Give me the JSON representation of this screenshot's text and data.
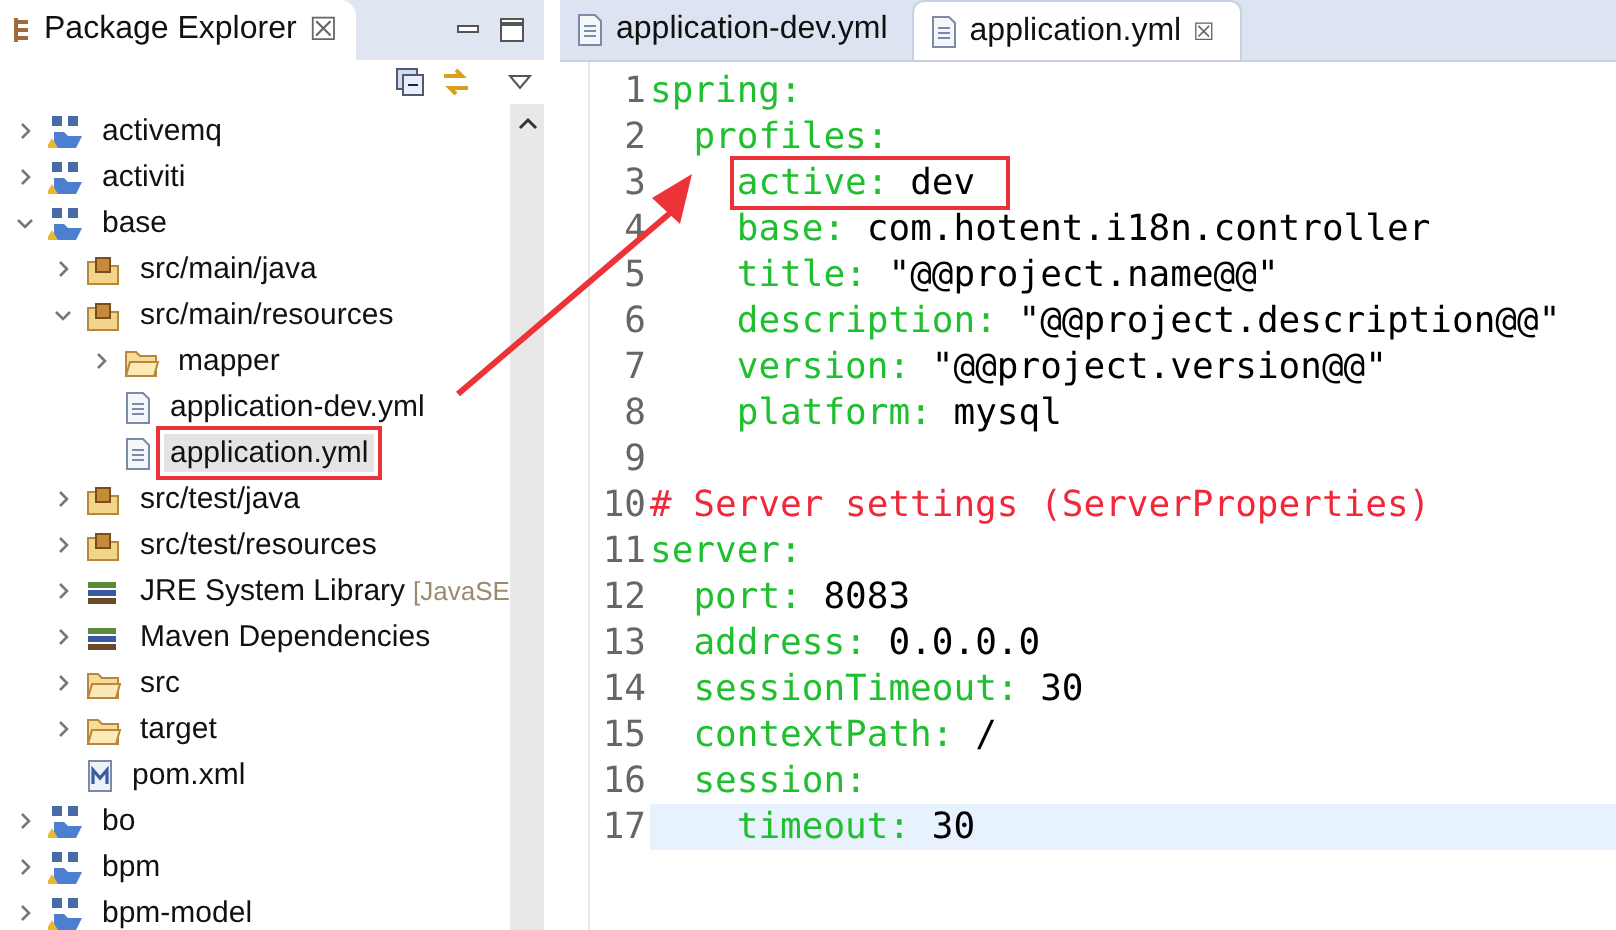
{
  "explorer": {
    "title": "Package Explorer",
    "close": "☒",
    "tree": [
      {
        "label": "activemq",
        "kind": "project",
        "expanded": false,
        "highlighted": false
      },
      {
        "label": "activiti",
        "kind": "project",
        "expanded": false,
        "highlighted": false
      },
      {
        "label": "base",
        "kind": "project",
        "expanded": true,
        "highlighted": false,
        "children": [
          {
            "label": "src/main/java",
            "kind": "package",
            "expanded": false,
            "highlighted": false
          },
          {
            "label": "src/main/resources",
            "kind": "package",
            "expanded": true,
            "highlighted": false,
            "children": [
              {
                "label": "mapper",
                "kind": "folder",
                "expanded": false,
                "highlighted": false
              },
              {
                "label": "application-dev.yml",
                "kind": "file",
                "highlighted": false
              },
              {
                "label": "application.yml",
                "kind": "file",
                "highlighted": true
              }
            ]
          },
          {
            "label": "src/test/java",
            "kind": "package",
            "expanded": false,
            "highlighted": false
          },
          {
            "label": "src/test/resources",
            "kind": "package",
            "expanded": false,
            "highlighted": false
          },
          {
            "label": "JRE System Library",
            "suffix": "[JavaSE",
            "kind": "library",
            "expanded": false,
            "highlighted": false
          },
          {
            "label": "Maven Dependencies",
            "kind": "library",
            "expanded": false,
            "highlighted": false
          },
          {
            "label": "src",
            "kind": "folder",
            "expanded": false,
            "highlighted": false
          },
          {
            "label": "target",
            "kind": "folder",
            "expanded": false,
            "highlighted": false
          },
          {
            "label": "pom.xml",
            "kind": "maven",
            "highlighted": false
          }
        ]
      },
      {
        "label": "bo",
        "kind": "project",
        "expanded": false,
        "highlighted": false
      },
      {
        "label": "bpm",
        "kind": "project",
        "expanded": false,
        "highlighted": false
      },
      {
        "label": "bpm-model",
        "kind": "project",
        "expanded": false,
        "highlighted": false
      }
    ]
  },
  "editor": {
    "tabs": [
      {
        "label": "application-dev.yml",
        "selected": false
      },
      {
        "label": "application.yml",
        "selected": true,
        "close": "☒"
      }
    ],
    "lines": [
      {
        "number": "1",
        "kind": "pair",
        "key": "spring:",
        "current": false,
        "highlighted": false
      },
      {
        "number": "2",
        "kind": "pair",
        "key": "  profiles:",
        "current": false,
        "highlighted": false
      },
      {
        "number": "3",
        "kind": "pair",
        "key": "    active:",
        "value": "dev",
        "current": false,
        "highlighted": true
      },
      {
        "number": "4",
        "kind": "pair",
        "key": "    base:",
        "value": "com.hotent.i18n.controller",
        "current": false,
        "highlighted": false
      },
      {
        "number": "5",
        "kind": "pair",
        "key": "    title:",
        "value": "\"@@project.name@@\"",
        "current": false,
        "highlighted": false
      },
      {
        "number": "6",
        "kind": "pair",
        "key": "    description:",
        "value": "\"@@project.description@@\"",
        "current": false,
        "highlighted": false
      },
      {
        "number": "7",
        "kind": "pair",
        "key": "    version:",
        "value": "\"@@project.version@@\"",
        "current": false,
        "highlighted": false
      },
      {
        "number": "8",
        "kind": "pair",
        "key": "    platform:",
        "value": "mysql",
        "current": false,
        "highlighted": false
      },
      {
        "number": "9",
        "kind": "blank",
        "current": false,
        "highlighted": false
      },
      {
        "number": "10",
        "kind": "comment",
        "text": "# Server settings (ServerProperties)",
        "current": false,
        "highlighted": false
      },
      {
        "number": "11",
        "kind": "pair",
        "key": "server:",
        "current": false,
        "highlighted": false
      },
      {
        "number": "12",
        "kind": "pair",
        "key": "  port:",
        "value": "8083",
        "current": false,
        "highlighted": false
      },
      {
        "number": "13",
        "kind": "pair",
        "key": "  address:",
        "value": "0.0.0.0",
        "current": false,
        "highlighted": false
      },
      {
        "number": "14",
        "kind": "pair",
        "key": "  sessionTimeout:",
        "value": "30",
        "current": false,
        "highlighted": false
      },
      {
        "number": "15",
        "kind": "pair",
        "key": "  contextPath:",
        "value": "/",
        "current": false,
        "highlighted": false
      },
      {
        "number": "16",
        "kind": "pair",
        "key": "  session:",
        "current": false,
        "highlighted": false
      },
      {
        "number": "17",
        "kind": "pair",
        "key": "    timeout:",
        "value": "30",
        "current": true,
        "highlighted": false
      }
    ]
  },
  "callout_arrow": true
}
